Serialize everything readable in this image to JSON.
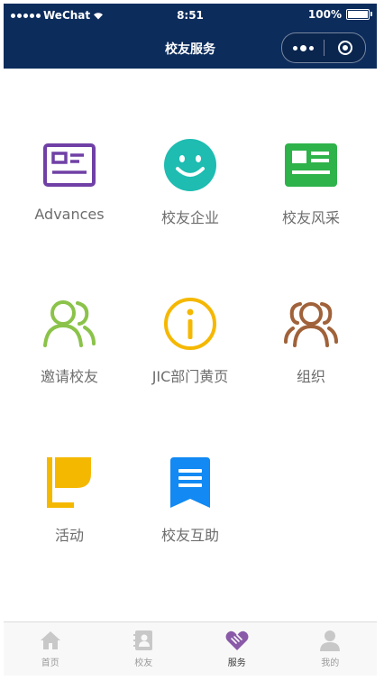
{
  "status_bar": {
    "carrier": "WeChat",
    "time": "8:51",
    "battery": "100%"
  },
  "nav": {
    "title": "校友服务"
  },
  "grid": {
    "items": [
      {
        "label": "Advances",
        "icon": "id-card-icon",
        "color": "#7040a6"
      },
      {
        "label": "校友企业",
        "icon": "smiley-face-icon",
        "color": "#1ebcb1"
      },
      {
        "label": "校友风采",
        "icon": "news-card-icon",
        "color": "#2eb24a"
      },
      {
        "label": "邀请校友",
        "icon": "users-icon",
        "color": "#8bc34a"
      },
      {
        "label": "JIC部门黄页",
        "icon": "info-icon",
        "color": "#f5b800"
      },
      {
        "label": "组织",
        "icon": "group-icon",
        "color": "#a0623a"
      },
      {
        "label": "活动",
        "icon": "flag-icon",
        "color": "#f5b800"
      },
      {
        "label": "校友互助",
        "icon": "bookmark-list-icon",
        "color": "#1289f3"
      }
    ]
  },
  "tabbar": {
    "active_color": "#8a5aa8",
    "inactive_color": "#c8c8c8",
    "tabs": [
      {
        "label": "首页",
        "icon": "home-icon"
      },
      {
        "label": "校友",
        "icon": "contacts-icon"
      },
      {
        "label": "服务",
        "icon": "handshake-heart-icon"
      },
      {
        "label": "我的",
        "icon": "person-icon"
      }
    ]
  }
}
